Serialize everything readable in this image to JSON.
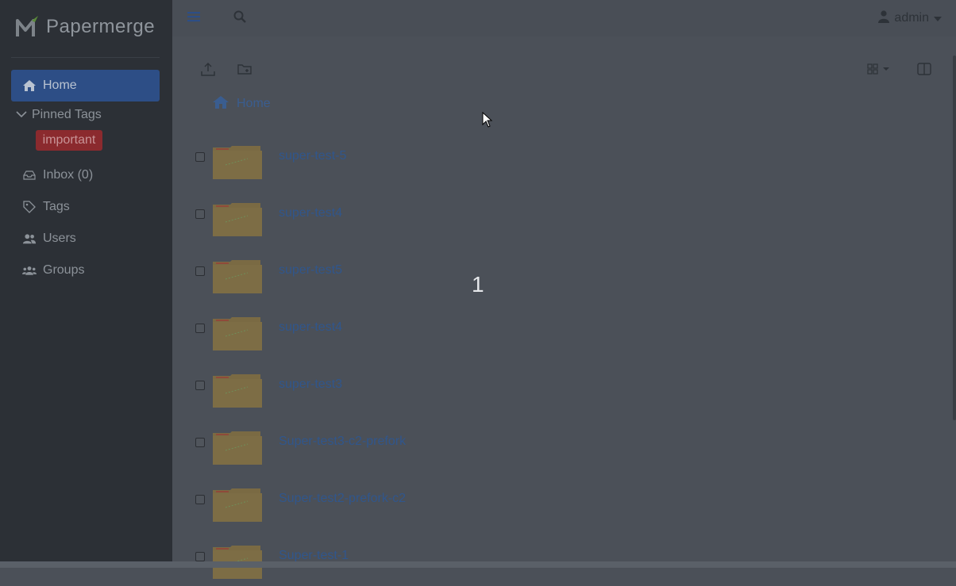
{
  "brand": {
    "name": "Papermerge"
  },
  "sidebar": {
    "home_label": "Home",
    "pinned_label": "Pinned Tags",
    "pinned_tags": [
      "important"
    ],
    "inbox_label": "Inbox (0)",
    "tags_label": "Tags",
    "users_label": "Users",
    "groups_label": "Groups"
  },
  "topbar": {
    "user_label": "admin"
  },
  "breadcrumb": {
    "home_label": "Home"
  },
  "folders": [
    "super-test-5",
    "super-test4",
    "super-test5",
    "super-test4",
    "super-test3",
    "Super-test3-c2-prefork",
    "Super-test2-prefork-c2",
    "Super-test-1"
  ],
  "overlay_number": "1",
  "colors": {
    "sidebar_bg": "#2c3036",
    "active_item": "#2d4e86",
    "tag_important": "#8b2a2e",
    "link": "#30568c",
    "folder": "#7a6a43"
  },
  "icons": {
    "menu": "bars-icon",
    "search": "search-icon",
    "user": "user-icon",
    "upload": "upload-icon",
    "new_folder": "folder-plus-icon",
    "view_mode": "grid-icon",
    "split_panel": "columns-icon"
  }
}
